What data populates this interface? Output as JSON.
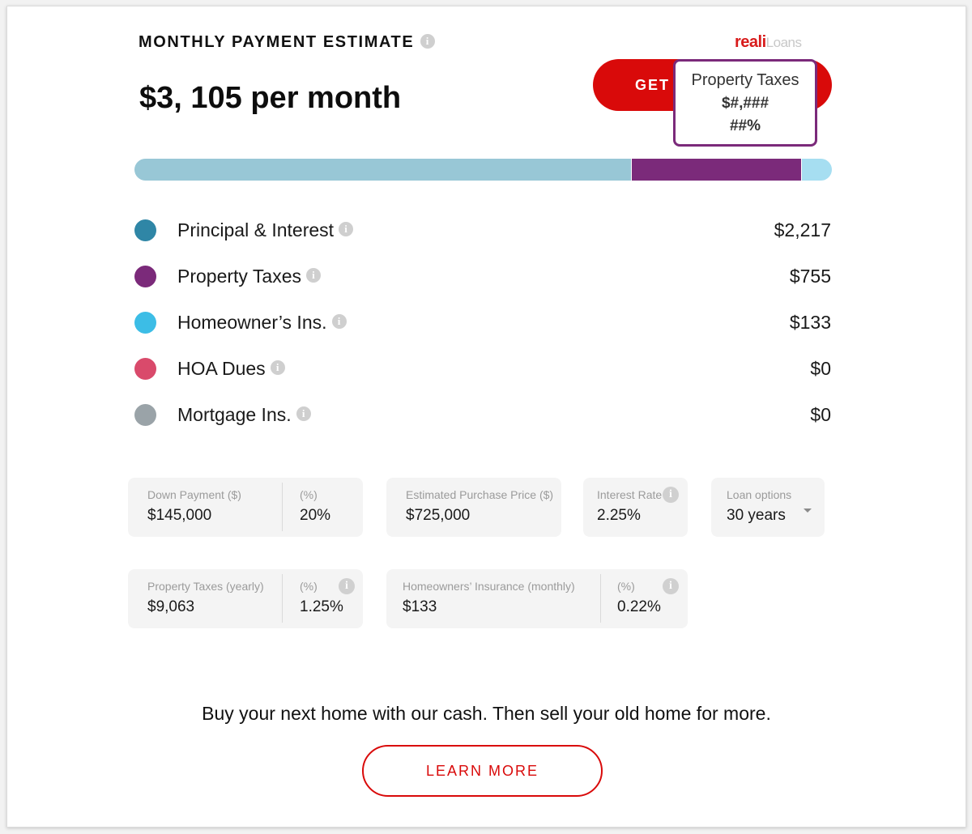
{
  "header": {
    "title": "MONTHLY PAYMENT ESTIMATE",
    "info_icon": "info-icon",
    "logo_primary": "reali",
    "logo_secondary": "Loans",
    "amount": "$3, 105 per month",
    "cta_label": "GET PRE-APPROVED"
  },
  "tooltip": {
    "title": "Property Taxes",
    "amount": "$#,###",
    "percent": "##%"
  },
  "colors": {
    "principal": "#2f86a6",
    "taxes": "#7b2a7a",
    "insurance": "#3cbde6",
    "hoa": "#d94a6b",
    "mortgage_ins": "#9aa3a8",
    "bar_principal": "#98c7d6",
    "bar_insurance": "#a6def1",
    "accent_red": "#d90a0a"
  },
  "breakdown": [
    {
      "label": "Principal & Interest",
      "value": "$2,217",
      "amount": 2217,
      "color": "#2f86a6"
    },
    {
      "label": "Property Taxes",
      "value": "$755",
      "amount": 755,
      "color": "#7b2a7a"
    },
    {
      "label": "Homeowner’s Ins.",
      "value": "$133",
      "amount": 133,
      "color": "#3cbde6"
    },
    {
      "label": "HOA Dues",
      "value": "$0",
      "amount": 0,
      "color": "#d94a6b"
    },
    {
      "label": "Mortgage Ins.",
      "value": "$0",
      "amount": 0,
      "color": "#9aa3a8"
    }
  ],
  "inputs": {
    "down_payment": {
      "label": "Down Payment ($)",
      "value": "$145,000"
    },
    "down_payment_pct": {
      "label": "(%)",
      "value": "20%"
    },
    "purchase_price": {
      "label": "Estimated Purchase Price ($)",
      "value": "$725,000"
    },
    "interest_rate": {
      "label": "Interest Rate",
      "value": "2.25%"
    },
    "loan_options": {
      "label": "Loan options",
      "value": "30 years"
    },
    "property_taxes": {
      "label": "Property Taxes (yearly)",
      "value": "$9,063"
    },
    "property_taxes_pct": {
      "label": "(%)",
      "value": "1.25%"
    },
    "insurance": {
      "label": "Homeowners’ Insurance (monthly)",
      "value": "$133"
    },
    "insurance_pct": {
      "label": "(%)",
      "value": "0.22%"
    }
  },
  "promo": {
    "tagline": "Buy your next home with our cash. Then sell your old home for more.",
    "button": "LEARN MORE"
  }
}
